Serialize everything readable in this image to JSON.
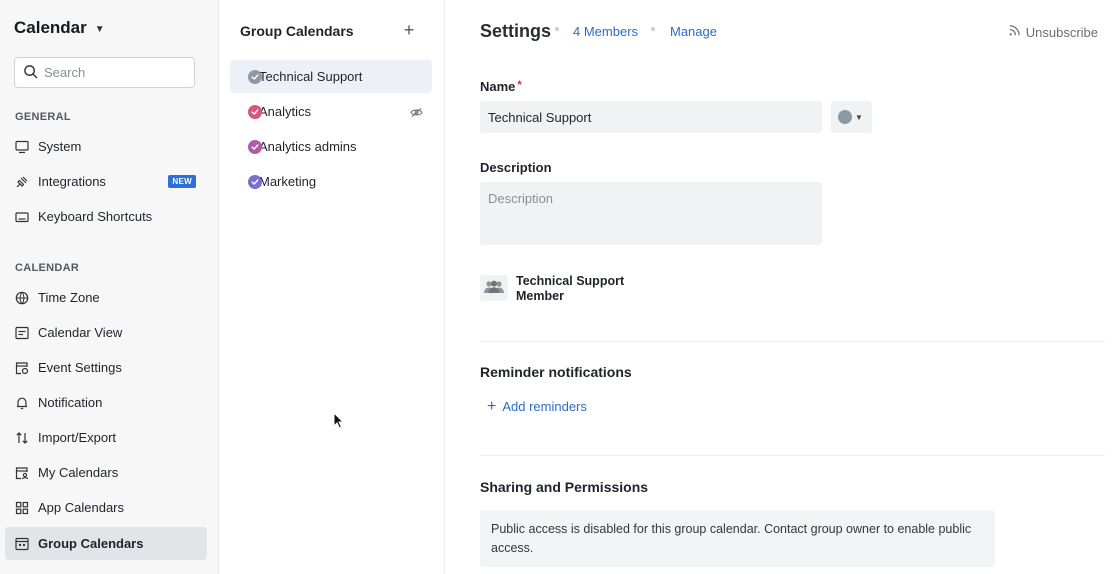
{
  "sidebar": {
    "app_title": "Calendar",
    "search_placeholder": "Search",
    "general_label": "GENERAL",
    "general_items": [
      {
        "label": "System",
        "icon": "monitor-icon"
      },
      {
        "label": "Integrations",
        "icon": "plug-icon",
        "badge": "NEW"
      },
      {
        "label": "Keyboard Shortcuts",
        "icon": "keyboard-icon"
      }
    ],
    "calendar_label": "CALENDAR",
    "calendar_items": [
      {
        "label": "Time Zone",
        "icon": "globe-icon"
      },
      {
        "label": "Calendar View",
        "icon": "calendar-view-icon"
      },
      {
        "label": "Event Settings",
        "icon": "event-settings-icon"
      },
      {
        "label": "Notification",
        "icon": "bell-icon"
      },
      {
        "label": "Import/Export",
        "icon": "import-export-icon"
      },
      {
        "label": "My Calendars",
        "icon": "my-calendars-icon"
      },
      {
        "label": "App Calendars",
        "icon": "app-grid-icon"
      },
      {
        "label": "Group Calendars",
        "icon": "group-calendar-icon",
        "active": true
      }
    ]
  },
  "group_calendars": {
    "title": "Group Calendars",
    "add_label": "+",
    "items": [
      {
        "label": "Technical Support",
        "color": "#8c9aa6",
        "active": true
      },
      {
        "label": "Analytics",
        "color": "#d9577a",
        "hidden": true
      },
      {
        "label": "Analytics admins",
        "color": "#b25aa6"
      },
      {
        "label": "Marketing",
        "color": "#7a6fd0"
      }
    ]
  },
  "settings": {
    "title": "Settings",
    "members_link": "4 Members",
    "manage_link": "Manage",
    "unsubscribe": "Unsubscribe",
    "name_label": "Name",
    "required_mark": "*",
    "name_value": "Technical Support",
    "calendar_color": "#8c9aa6",
    "description_label": "Description",
    "description_placeholder": "Description",
    "member_line1": "Technical Support",
    "member_line2": "Member",
    "reminder_title": "Reminder notifications",
    "add_reminders": "Add reminders",
    "sharing_title": "Sharing and Permissions",
    "sharing_notice": "Public access is disabled for this group calendar. Contact group owner to enable public access."
  },
  "colors": {
    "accent": "#2c6bc8",
    "badge": "#2d6fd8",
    "required": "#d62b2b"
  }
}
